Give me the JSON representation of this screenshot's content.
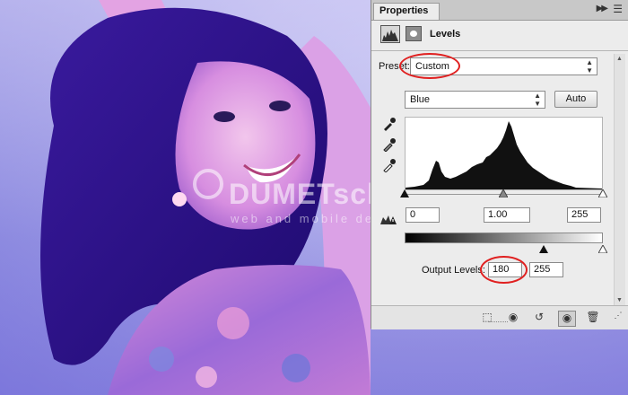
{
  "panel": {
    "tab_label": "Properties",
    "adjustment_title": "Levels",
    "preset_label": "Preset:",
    "preset_value": "Custom",
    "channel_value": "Blue",
    "auto_label": "Auto",
    "input_black": "0",
    "input_gamma": "1.00",
    "input_white": "255",
    "output_label": "Output Levels:",
    "output_black": "180",
    "output_white": "255"
  },
  "photo": {
    "watermark_brand": "DUMETschool",
    "watermark_sub": "web and mobile design"
  },
  "icons": [
    "levels-histogram-icon",
    "layer-mask-icon",
    "black-point-eyedropper-icon",
    "gray-point-eyedropper-icon",
    "white-point-eyedropper-icon",
    "clip-to-layer-icon",
    "view-previous-state-icon",
    "reset-icon",
    "visibility-eye-icon",
    "trash-icon"
  ],
  "colors": {
    "annotation": "#e02020",
    "panel_bg": "#ececec",
    "histogram": "#111111"
  }
}
